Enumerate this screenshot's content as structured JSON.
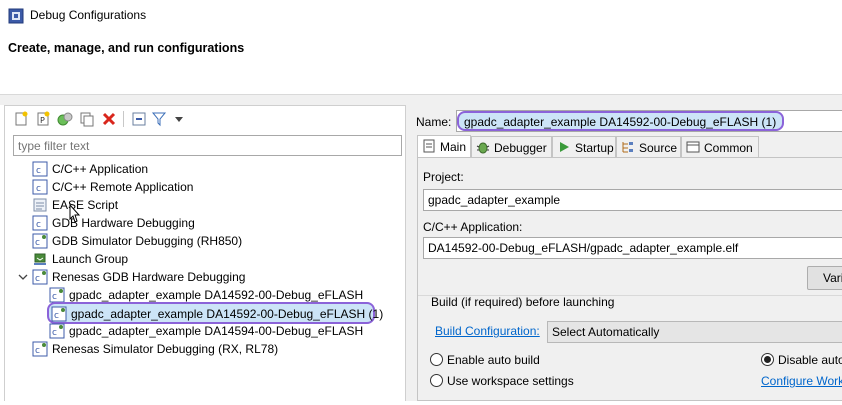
{
  "window": {
    "title": "Debug Configurations"
  },
  "banner": {
    "title": "Create, manage, and run configurations"
  },
  "toolbar": {
    "icons": [
      "new-config-icon",
      "new-prototype-icon",
      "export-icon",
      "duplicate-icon",
      "delete-icon",
      "collapse-all-icon",
      "filter-icon",
      "dropdown-icon"
    ]
  },
  "filter": {
    "placeholder": "type filter text"
  },
  "tree": {
    "items": [
      {
        "label": "C/C++ Application"
      },
      {
        "label": "C/C++ Remote Application"
      },
      {
        "label": "EASE Script"
      },
      {
        "label": "GDB Hardware Debugging"
      },
      {
        "label": "GDB Simulator Debugging (RH850)"
      },
      {
        "label": "Launch Group"
      },
      {
        "label": "Renesas GDB Hardware Debugging"
      },
      {
        "label": "gpadc_adapter_example DA14592-00-Debug_eFLASH"
      },
      {
        "label": "gpadc_adapter_example DA14592-00-Debug_eFLASH (1)"
      },
      {
        "label": "gpadc_adapter_example DA14594-00-Debug_eFLASH"
      },
      {
        "label": "Renesas Simulator Debugging (RX, RL78)"
      }
    ]
  },
  "editor": {
    "name_label": "Name:",
    "name_value": "gpadc_adapter_example DA14592-00-Debug_eFLASH (1)",
    "tabs": [
      {
        "label": "Main"
      },
      {
        "label": "Debugger"
      },
      {
        "label": "Startup"
      },
      {
        "label": "Source"
      },
      {
        "label": "Common"
      }
    ],
    "project_label": "Project:",
    "project_value": "gpadc_adapter_example",
    "app_label": "C/C++ Application:",
    "app_value": "DA14592-00-Debug_eFLASH/gpadc_adapter_example.elf",
    "variables_button": "Vari",
    "build_group_label": "Build (if required) before launching",
    "build_config_link": "Build Configuration:",
    "build_config_value": "Select Automatically",
    "enable_auto_build": "Enable auto build",
    "disable_auto_build": "Disable auto",
    "use_workspace": "Use workspace settings",
    "configure_workspace_link": "Configure Work"
  },
  "colors": {
    "selection": "#cce4f7",
    "highlight_ring": "#8b63d9",
    "link": "#0066cc"
  }
}
